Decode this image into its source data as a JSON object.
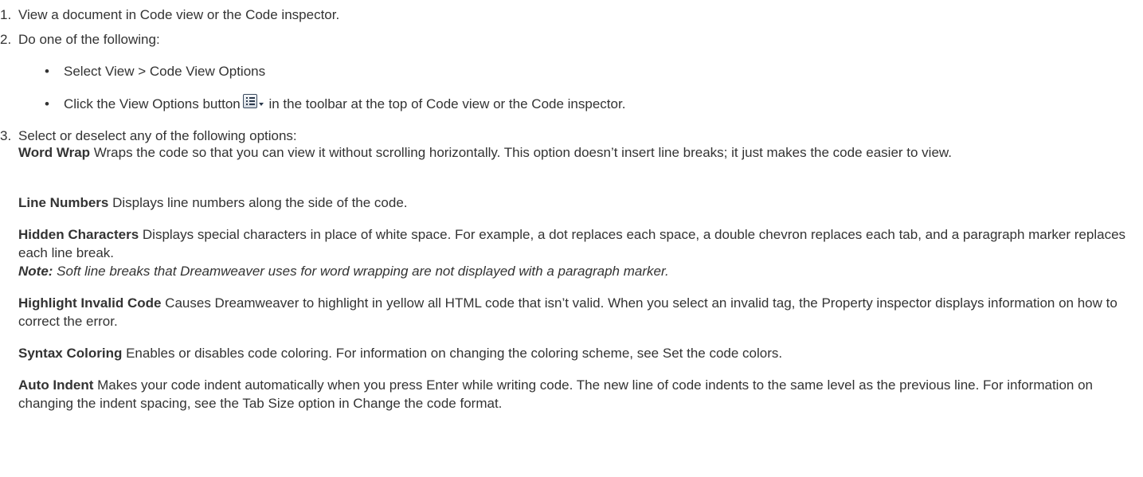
{
  "steps": [
    {
      "num": "1.",
      "text": "View a document in Code view or the Code inspector."
    },
    {
      "num": "2.",
      "text": "Do one of the following:",
      "bullets": [
        {
          "text": "Select View > Code View Options"
        },
        {
          "before": "Click the View Options button",
          "icon": "view-options-icon",
          "after": " in the toolbar at the top of Code view or the Code inspector."
        }
      ]
    },
    {
      "num": "3.",
      "text": "Select or deselect any of the following options:"
    }
  ],
  "options": [
    {
      "term": "Word Wrap",
      "desc": " Wraps the code so that you can view it without scrolling horizontally. This option doesn’t insert line breaks; it just makes the code easier to view."
    },
    {
      "term": "Line Numbers",
      "desc": " Displays line numbers along the side of the code."
    },
    {
      "term": "Hidden Characters",
      "desc": " Displays special characters in place of white space. For example, a dot replaces each space, a double chevron replaces each tab, and a paragraph marker replaces each line break.",
      "note_label": "Note:",
      "note_text": " Soft line breaks that Dreamweaver uses for word wrapping are not displayed with a paragraph marker."
    },
    {
      "term": "Highlight Invalid Code",
      "desc": " Causes Dreamweaver to highlight in yellow all HTML code that isn’t valid. When you select an invalid tag, the Property inspector displays information on how to correct the error."
    },
    {
      "term": "Syntax Coloring",
      "desc": " Enables or disables code coloring. For information on changing the coloring scheme, see Set the code colors."
    },
    {
      "term": "Auto Indent",
      "desc": " Makes your code indent automatically when you press Enter while writing code. The new line of code indents to the same level as the previous line. For information on changing the indent spacing, see the Tab Size option in Change the code format."
    }
  ]
}
